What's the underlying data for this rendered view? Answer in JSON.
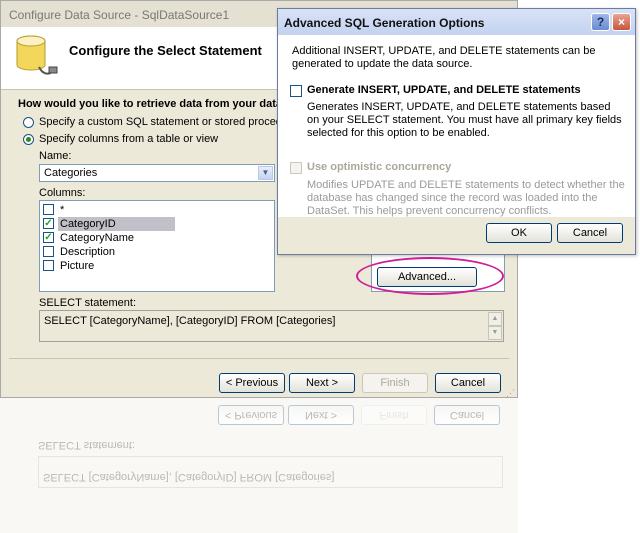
{
  "wizard": {
    "title": "Configure Data Source - SqlDataSource1",
    "header": "Configure the Select Statement",
    "question": "How would you like to retrieve data from your data source?",
    "question_visible": "How would you like to retrieve data from your data",
    "option_custom_sql": "Specify a custom SQL statement or stored procedure",
    "option_columns": "Specify columns from a table or view",
    "selected_option": "option_columns",
    "name_label": "Name:",
    "name_value": "Categories",
    "columns_label": "Columns:",
    "columns": [
      {
        "label": "*",
        "checked": false,
        "selected": false
      },
      {
        "label": "CategoryID",
        "checked": true,
        "selected": true
      },
      {
        "label": "CategoryName",
        "checked": true,
        "selected": false
      },
      {
        "label": "Description",
        "checked": false,
        "selected": false
      },
      {
        "label": "Picture",
        "checked": false,
        "selected": false
      }
    ],
    "advanced_label": "Advanced...",
    "select_label": "SELECT statement:",
    "select_value": "SELECT [CategoryName], [CategoryID] FROM [Categories]",
    "prev_label": "< Previous",
    "next_label": "Next >",
    "finish_label": "Finish",
    "cancel_label": "Cancel"
  },
  "dialog": {
    "title": "Advanced SQL Generation Options",
    "help_label": "?",
    "close_label": "×",
    "intro": "Additional INSERT, UPDATE, and DELETE statements can be generated to update the data source.",
    "generate_label": "Generate INSERT, UPDATE, and DELETE statements",
    "generate_checked": false,
    "generate_desc": "Generates INSERT, UPDATE, and DELETE statements based on your SELECT statement. You must have all primary key fields selected for this option to be enabled.",
    "optimistic_label": "Use optimistic concurrency",
    "optimistic_checked": false,
    "optimistic_enabled": false,
    "optimistic_desc": "Modifies UPDATE and DELETE statements to detect whether the database has changed since the record was loaded into the DataSet. This helps prevent concurrency conflicts.",
    "ok_label": "OK",
    "cancel_label": "Cancel"
  },
  "colors": {
    "window_bg": "#ece9d8",
    "highlight_ellipse": "#d01d96",
    "check_green": "#21a121"
  }
}
